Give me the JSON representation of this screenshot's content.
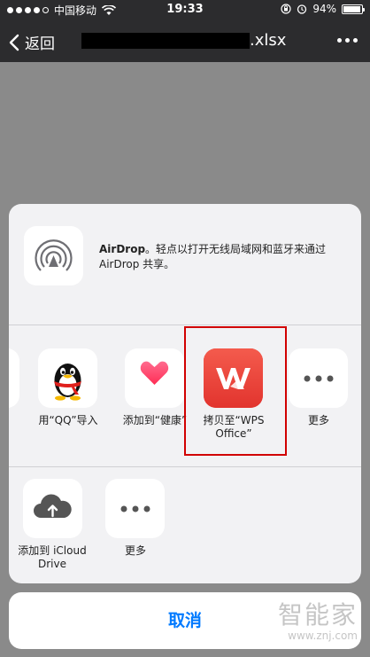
{
  "status_bar": {
    "carrier": "中国移动",
    "time": "19:33",
    "battery": "94%",
    "battery_level": 0.94
  },
  "nav": {
    "back_label": "返回",
    "title_suffix": ".xlsx"
  },
  "airdrop": {
    "title": "AirDrop",
    "description": "。轻点以打开无线局域网和蓝牙来通过 AirDrop 共享。"
  },
  "apps": [
    {
      "label": "用“QQ”导入",
      "icon": "qq-penguin-icon"
    },
    {
      "label": "添加到“健康”",
      "icon": "health-heart-icon"
    },
    {
      "label": "拷贝至“WPS Office”",
      "icon": "wps-office-icon"
    },
    {
      "label": "更多",
      "icon": "more-icon"
    }
  ],
  "actions": [
    {
      "label": "添加到 iCloud Drive",
      "icon": "icloud-upload-icon"
    },
    {
      "label": "更多",
      "icon": "more-icon"
    }
  ],
  "cancel_label": "取消",
  "watermark": {
    "logo": "智能家",
    "url": "www.znj.com"
  },
  "colors": {
    "accent": "#007aff",
    "wps_red": "#e8483f",
    "highlight": "#d10000"
  }
}
